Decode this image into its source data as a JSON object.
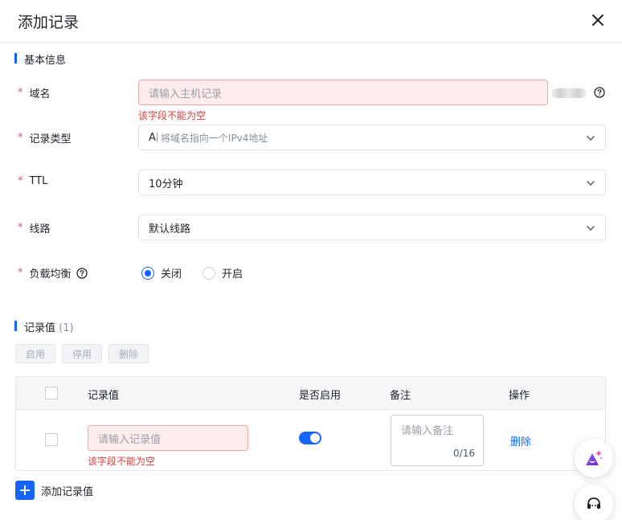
{
  "dialog": {
    "title": "添加记录"
  },
  "basic_section": {
    "title": "基本信息"
  },
  "form": {
    "required_mark": "*",
    "domain": {
      "label": "域名",
      "placeholder": "请输入主机记录",
      "error": "该字段不能为空"
    },
    "record_type": {
      "label": "记录类型",
      "value": "A",
      "hint": "将域名指向一个IPv4地址"
    },
    "ttl": {
      "label": "TTL",
      "value": "10分钟"
    },
    "line": {
      "label": "线路",
      "value": "默认线路"
    },
    "load_balance": {
      "label": "负载均衡",
      "options": [
        "关闭",
        "开启"
      ],
      "selected": "关闭"
    }
  },
  "records_section": {
    "title": "记录值",
    "count": "(1)"
  },
  "toolbar": {
    "enable": "启用",
    "disable": "停用",
    "delete": "删除"
  },
  "table": {
    "columns": [
      "记录值",
      "是否启用",
      "备注",
      "操作"
    ],
    "row": {
      "value_placeholder": "请输入记录值",
      "value_error": "该字段不能为空",
      "enabled": true,
      "remark_placeholder": "请输入备注",
      "remark_counter": "0/16",
      "action": "删除"
    }
  },
  "add_record": {
    "label": "添加记录值"
  },
  "colors": {
    "primary": "#1664ff",
    "error": "#d83b3b",
    "error_bg": "#fdecec"
  },
  "icons": {
    "close": "close-icon",
    "help": "help-circle-icon",
    "chevron": "chevron-down-icon",
    "ai": "ai-assistant-icon",
    "support": "customer-service-icon"
  }
}
